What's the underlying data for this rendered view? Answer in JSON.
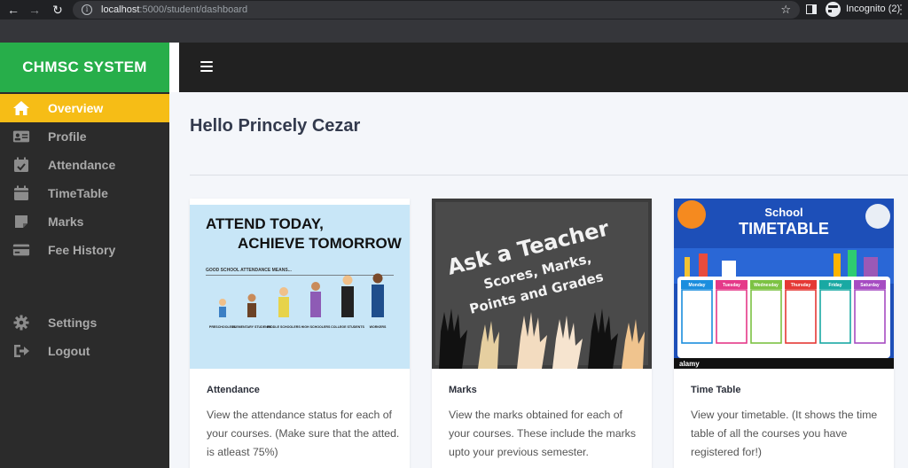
{
  "browser": {
    "url_host": "localhost",
    "url_path": ":5000/student/dashboard",
    "incognito_label": "Incognito (2)"
  },
  "sidebar": {
    "brand": "CHMSC SYSTEM",
    "items": [
      {
        "label": "Overview",
        "icon": "home-icon",
        "active": true
      },
      {
        "label": "Profile",
        "icon": "id-card-icon"
      },
      {
        "label": "Attendance",
        "icon": "calendar-check-icon"
      },
      {
        "label": "TimeTable",
        "icon": "calendar-icon"
      },
      {
        "label": "Marks",
        "icon": "note-icon"
      },
      {
        "label": "Fee History",
        "icon": "credit-card-icon"
      },
      {
        "label": "Settings",
        "icon": "gear-icon"
      },
      {
        "label": "Logout",
        "icon": "sign-out-icon"
      }
    ]
  },
  "main": {
    "greeting": "Hello Princely Cezar",
    "cards": [
      {
        "title": "Attendance",
        "description": "View the attendance status for each of your courses. (Make sure that the atted. is atleast 75%)",
        "image": {
          "headline_1": "ATTEND TODAY,",
          "headline_2": "ACHIEVE TOMORROW",
          "subtitle": "GOOD SCHOOL ATTENDANCE MEANS...",
          "stages": [
            "PRESCHOOLERS",
            "ELEMENTARY STUDENTS",
            "MIDDLE SCHOOLERS",
            "HIGH SCHOOLERS",
            "COLLEGE STUDENTS",
            "WORKERS"
          ]
        }
      },
      {
        "title": "Marks",
        "description": "View the marks obtained for each of your courses. These include the marks upto your previous semester.",
        "image": {
          "line_1": "Ask a Teacher",
          "line_2": "Scores, Marks,",
          "line_3": "Points and Grades"
        }
      },
      {
        "title": "Time Table",
        "description": "View your timetable. (It shows the time table of all the courses you have registered for!)",
        "image": {
          "heading_1": "School",
          "heading_2": "TIMETABLE",
          "days": [
            "Monday",
            "Tuesday",
            "Wednesday",
            "Thursday",
            "Friday",
            "Saturday"
          ],
          "watermark": "alamy"
        }
      }
    ]
  },
  "colors": {
    "brand_green": "#27ae4a",
    "active_yellow": "#f6bd16",
    "sidebar_bg": "#2b2b2b",
    "topbar_bg": "#212121"
  }
}
